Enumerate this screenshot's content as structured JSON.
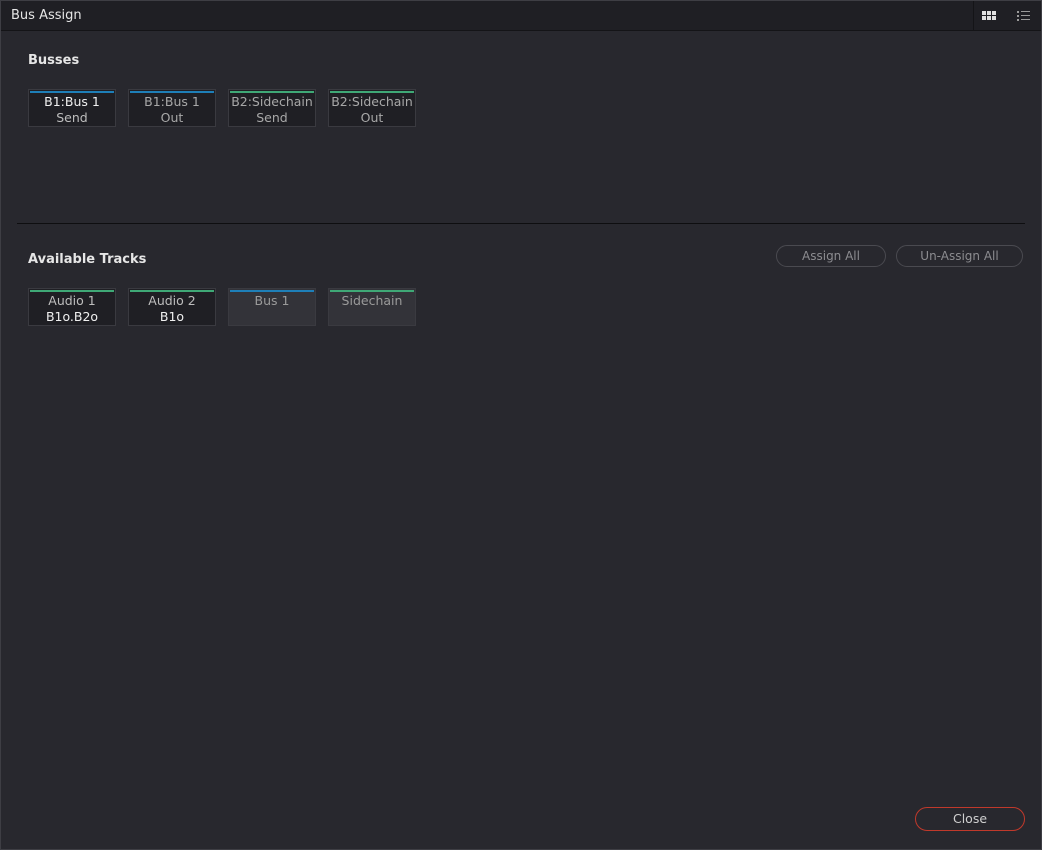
{
  "window": {
    "title": "Bus Assign"
  },
  "toolbar": {
    "grid_view_icon": "grid-view-icon",
    "list_view_icon": "list-view-icon"
  },
  "busses": {
    "label": "Busses",
    "tiles": [
      {
        "line1": "B1:Bus 1",
        "line2": "Send",
        "accent": "#1e7fb8",
        "active": true
      },
      {
        "line1": "B1:Bus 1",
        "line2": "Out",
        "accent": "#1e7fb8",
        "active": false
      },
      {
        "line1": "B2:Sidechain",
        "line2": "Send",
        "accent": "#3fa876",
        "active": false
      },
      {
        "line1": "B2:Sidechain",
        "line2": "Out",
        "accent": "#3fa876",
        "active": false
      }
    ]
  },
  "tracks": {
    "label": "Available Tracks",
    "assign_all": "Assign All",
    "unassign_all": "Un-Assign All",
    "tiles": [
      {
        "line1": "Audio 1",
        "line2": "B1o.B2o",
        "accent": "#3fa876"
      },
      {
        "line1": "Audio 2",
        "line2": "B1o",
        "accent": "#3fa876"
      },
      {
        "line1": "Bus 1",
        "line2": "",
        "accent": "#1e7fb8"
      },
      {
        "line1": "Sidechain",
        "line2": "",
        "accent": "#3fa876"
      }
    ]
  },
  "footer": {
    "close": "Close"
  }
}
